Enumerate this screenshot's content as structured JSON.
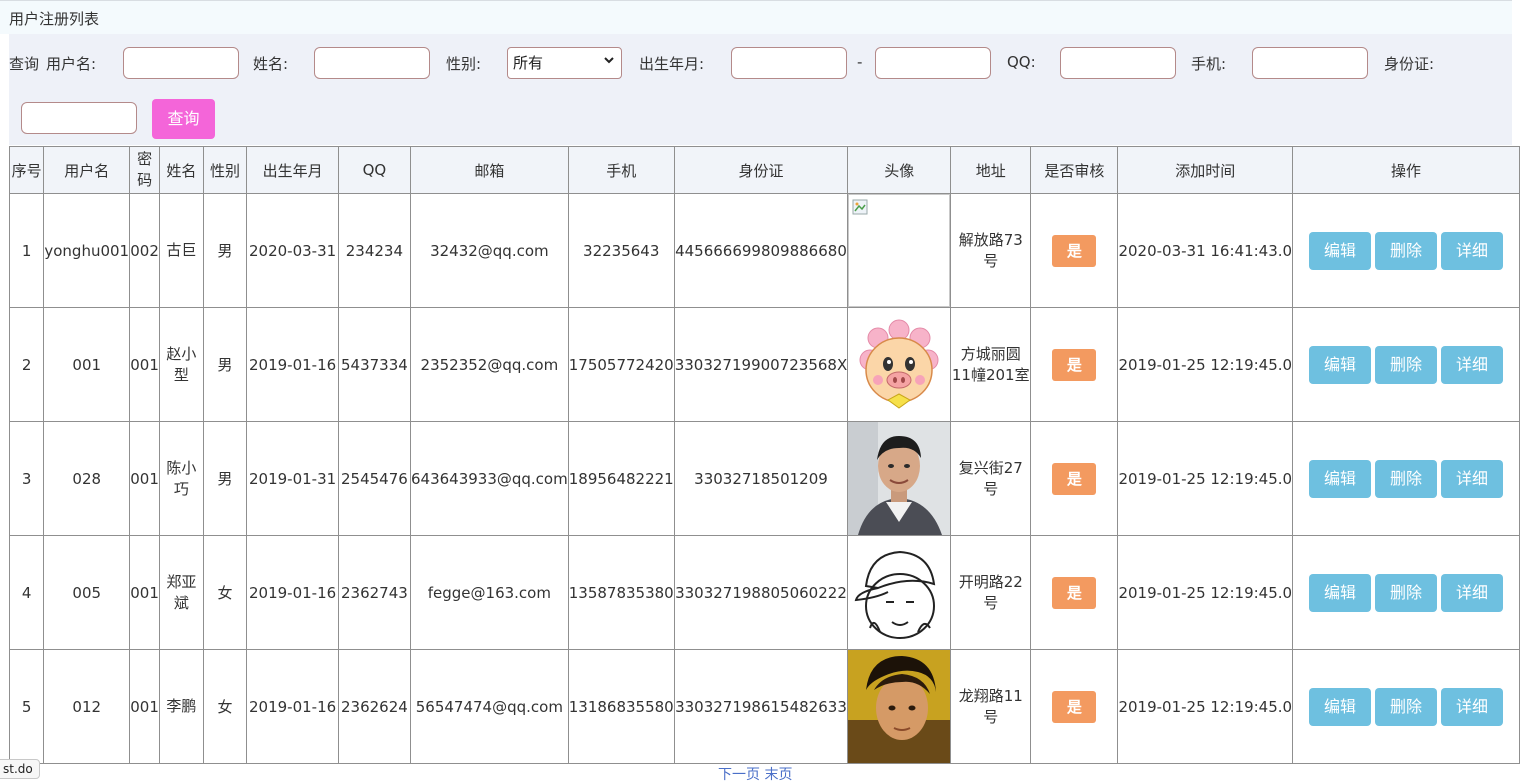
{
  "page": {
    "title": "用户注册列表"
  },
  "filters": {
    "query_label": "查询",
    "username_label": "用户名:",
    "name_label": "姓名:",
    "gender_label": "性别:",
    "gender_selected": "所有",
    "birth_label": "出生年月:",
    "range_separator": "-",
    "qq_label": "QQ:",
    "phone_label": "手机:",
    "idcard_label": "身份证:",
    "search_button": "查询"
  },
  "table": {
    "headers": [
      "序号",
      "用户名",
      "密码",
      "姓名",
      "性别",
      "出生年月",
      "QQ",
      "邮箱",
      "手机",
      "身份证",
      "头像",
      "地址",
      "是否审核",
      "添加时间",
      "操作"
    ],
    "rows": [
      {
        "index": "1",
        "username": "yonghu001",
        "password": "002",
        "name": "古巨",
        "gender": "男",
        "birth": "2020-03-31",
        "qq": "234234",
        "email": "32432@qq.com",
        "phone": "32235643",
        "idcard": "445666699809886680",
        "avatar": "broken-image-icon",
        "address": "解放路73号",
        "approved": "是",
        "added": "2020-03-31 16:41:43.0"
      },
      {
        "index": "2",
        "username": "001",
        "password": "001",
        "name": "赵小型",
        "gender": "男",
        "birth": "2019-01-16",
        "qq": "5437334",
        "email": "2352352@qq.com",
        "phone": "17505772420",
        "idcard": "33032719900723568X",
        "avatar": "cartoon-pig-avatar",
        "address": "方城丽圆11幢201室",
        "approved": "是",
        "added": "2019-01-25 12:19:45.0"
      },
      {
        "index": "3",
        "username": "028",
        "password": "001",
        "name": "陈小巧",
        "gender": "男",
        "birth": "2019-01-31",
        "qq": "2545476",
        "email": "643643933@qq.com",
        "phone": "18956482221",
        "idcard": "33032718501209",
        "avatar": "man-portrait-avatar",
        "address": "复兴街27号",
        "approved": "是",
        "added": "2019-01-25 12:19:45.0"
      },
      {
        "index": "4",
        "username": "005",
        "password": "001",
        "name": "郑亚斌",
        "gender": "女",
        "birth": "2019-01-16",
        "qq": "2362743",
        "email": "fegge@163.com",
        "phone": "13587835380",
        "idcard": "330327198805060222",
        "avatar": "sketch-cap-avatar",
        "address": "开明路22号",
        "approved": "是",
        "added": "2019-01-25 12:19:45.0"
      },
      {
        "index": "5",
        "username": "012",
        "password": "001",
        "name": "李鹏",
        "gender": "女",
        "birth": "2019-01-16",
        "qq": "2362624",
        "email": "56547474@qq.com",
        "phone": "13186835580",
        "idcard": "330327198615482633",
        "avatar": "young-man-avatar",
        "address": "龙翔路11号",
        "approved": "是",
        "added": "2019-01-25 12:19:45.0"
      }
    ],
    "actions": {
      "edit": "编辑",
      "delete": "删除",
      "detail": "详细"
    }
  },
  "status_tooltip": "st.do",
  "pager": {
    "text": "下一页 末页"
  },
  "colors": {
    "title_bg": "#f4fafd",
    "filter_bg": "#eef1f8",
    "search_button": "#f465d9",
    "badge": "#f39a60",
    "action_button": "#6ec0e0",
    "border": "#8f8f8f"
  }
}
